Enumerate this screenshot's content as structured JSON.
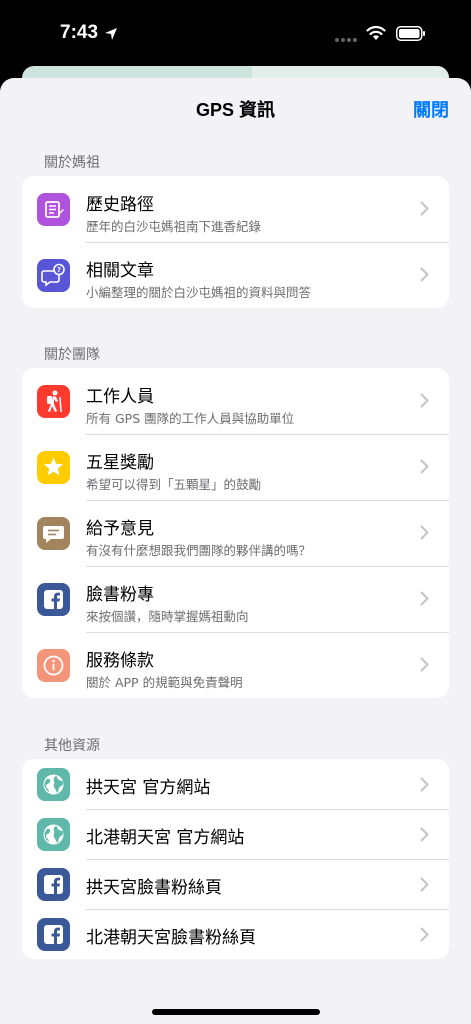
{
  "status_bar": {
    "time": "7:43",
    "location_icon": "location-arrow-icon",
    "signal_icon": "signal-dots-icon",
    "wifi_icon": "wifi-icon",
    "battery_icon": "battery-icon"
  },
  "sheet": {
    "title": "GPS 資訊",
    "close_label": "關閉"
  },
  "sections": [
    {
      "header": "關於媽祖",
      "items": [
        {
          "title": "歷史路徑",
          "subtitle": "歷年的白沙屯媽祖南下進香紀錄",
          "icon": "scroll-icon",
          "icon_color": "#af52de"
        },
        {
          "title": "相關文章",
          "subtitle": "小編整理的關於白沙屯媽祖的資料與問答",
          "icon": "chat-question-icon",
          "icon_color": "#5856d6"
        }
      ]
    },
    {
      "header": "關於團隊",
      "items": [
        {
          "title": "工作人員",
          "subtitle": "所有 GPS 團隊的工作人員與協助單位",
          "icon": "hiker-icon",
          "icon_color": "#ff3b30"
        },
        {
          "title": "五星獎勵",
          "subtitle": "希望可以得到「五顆星」的鼓勵",
          "icon": "star-icon",
          "icon_color": "#ffcc00"
        },
        {
          "title": "給予意見",
          "subtitle": "有沒有什麼想跟我們團隊的夥伴講的嗎？",
          "icon": "message-icon",
          "icon_color": "#a2845e"
        },
        {
          "title": "臉書粉專",
          "subtitle": "來按個讚，隨時掌握媽祖動向",
          "icon": "facebook-icon",
          "icon_color": "#3b5998"
        },
        {
          "title": "服務條款",
          "subtitle": "關於 APP 的規範與免責聲明",
          "icon": "info-icon",
          "icon_color": "#f4957a"
        }
      ]
    },
    {
      "header": "其他資源",
      "items": [
        {
          "title": "拱天宮 官方網站",
          "icon": "globe-icon",
          "icon_color": "#5fb8a9"
        },
        {
          "title": "北港朝天宮 官方網站",
          "icon": "globe-icon",
          "icon_color": "#5fb8a9"
        },
        {
          "title": "拱天宮臉書粉絲頁",
          "icon": "facebook-icon",
          "icon_color": "#3b5998"
        },
        {
          "title": "北港朝天宮臉書粉絲頁",
          "icon": "facebook-icon",
          "icon_color": "#3b5998"
        }
      ]
    }
  ]
}
